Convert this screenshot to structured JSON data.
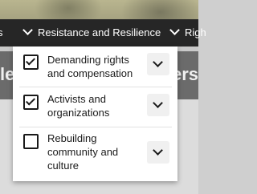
{
  "background": {
    "banner_left_text": "le",
    "banner_right_text": "ers"
  },
  "navbar": {
    "prev_label": "s",
    "current_label": "Resistance and Resilience",
    "next_label": "Righ"
  },
  "dropdown": {
    "items": [
      {
        "label": "Demanding rights and compensation",
        "checked": true
      },
      {
        "label": "Activists and organizations",
        "checked": true
      },
      {
        "label": "Rebuilding community and culture",
        "checked": false
      }
    ]
  },
  "colors": {
    "navbar_bg": "#262626",
    "dropdown_bg": "#ffffff",
    "expand_button_bg": "#f0f0f0",
    "text": "#1a1a1a"
  }
}
